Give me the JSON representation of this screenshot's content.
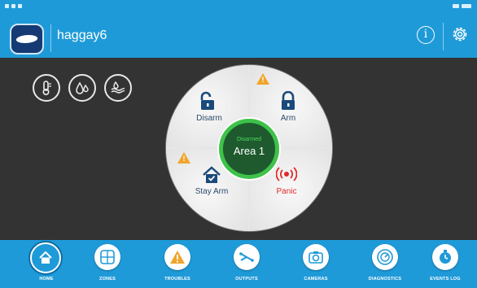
{
  "header": {
    "username": "haggay6",
    "info_icon": "info-icon",
    "settings_icon": "gear-icon"
  },
  "sensors": [
    {
      "name": "temperature-icon"
    },
    {
      "name": "water-leak-icon"
    },
    {
      "name": "flood-icon"
    }
  ],
  "dial": {
    "quadrants": {
      "disarm": "Disarm",
      "arm": "Arm",
      "stay_arm": "Stay Arm",
      "panic": "Panic"
    },
    "center": {
      "status": "Disarmed",
      "area": "Area 1"
    },
    "warning_symbol": "!"
  },
  "nav": {
    "items": [
      {
        "label": "HOME",
        "icon": "home-icon"
      },
      {
        "label": "ZONES",
        "icon": "zones-grid-icon"
      },
      {
        "label": "TROUBLES",
        "icon": "warning-icon"
      },
      {
        "label": "OUTPUTS",
        "icon": "outputs-icon"
      },
      {
        "label": "CAMERAS",
        "icon": "camera-icon"
      },
      {
        "label": "DIAGNOSTICS",
        "icon": "diagnostics-icon"
      },
      {
        "label": "EVENTS LOG",
        "icon": "events-log-icon"
      }
    ]
  },
  "colors": {
    "brand_blue": "#1f9ad8",
    "status_green": "#3ec24a",
    "warning_orange": "#f0a52a",
    "panic_red": "#e02a2a",
    "background": "#333333"
  }
}
